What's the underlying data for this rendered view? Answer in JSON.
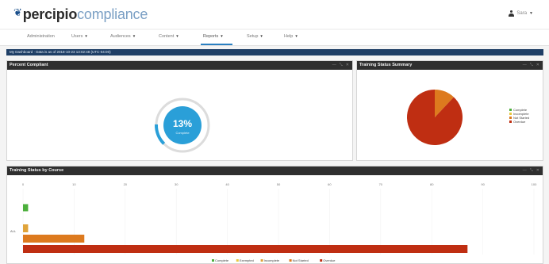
{
  "header": {
    "logo_brand": "percipio",
    "logo_product": "compliance",
    "user_name": "Sara"
  },
  "nav": {
    "items": [
      {
        "label": "Administration",
        "has_caret": false
      },
      {
        "label": "Users",
        "has_caret": true
      },
      {
        "label": "Audiences",
        "has_caret": true
      },
      {
        "label": "Content",
        "has_caret": true
      },
      {
        "label": "Reports",
        "has_caret": true,
        "active": true
      },
      {
        "label": "Setup",
        "has_caret": true
      },
      {
        "label": "Help",
        "has_caret": true
      }
    ]
  },
  "dashboard_bar": {
    "text": "My Dashboard · Data is as of 2018-10-23 13:02:48 (UTC-04:00)"
  },
  "panels": {
    "percent_compliant": {
      "title": "Percent Compliant",
      "value_label": "13%",
      "sub_label": "Complete",
      "fraction": 0.13
    },
    "status_summary": {
      "title": "Training Status Summary"
    },
    "status_by_course": {
      "title": "Training Status by Course"
    }
  },
  "colors": {
    "complete": "#4caf3c",
    "exempted": "#e8c840",
    "incomplete": "#e0a43a",
    "not_started": "#dd7a1e",
    "overdue": "#bf2e12",
    "accent": "#2a9fd8"
  },
  "chart_data": [
    {
      "type": "pie",
      "categories": [
        "Complete",
        "Incomplete",
        "Not Started",
        "Overdue"
      ],
      "values": [
        0,
        0,
        12,
        88
      ],
      "colors": [
        "#4caf3c",
        "#e8c840",
        "#dd7a1e",
        "#bf2e12"
      ],
      "legend_position": "right"
    },
    {
      "type": "bar",
      "orientation": "horizontal",
      "categories": [
        "ALL"
      ],
      "series": [
        {
          "name": "Complete",
          "values": [
            1
          ],
          "color": "#4caf3c"
        },
        {
          "name": "Exempted",
          "values": [
            0
          ],
          "color": "#e8c840"
        },
        {
          "name": "Incomplete",
          "values": [
            1
          ],
          "color": "#e0a43a"
        },
        {
          "name": "Not Started",
          "values": [
            12
          ],
          "color": "#dd7a1e"
        },
        {
          "name": "Overdue",
          "values": [
            87
          ],
          "color": "#bf2e12"
        }
      ],
      "xlim": [
        0,
        100
      ],
      "xticks": [
        0,
        10,
        20,
        30,
        40,
        50,
        60,
        70,
        80,
        90,
        100
      ],
      "legend_position": "bottom"
    }
  ]
}
